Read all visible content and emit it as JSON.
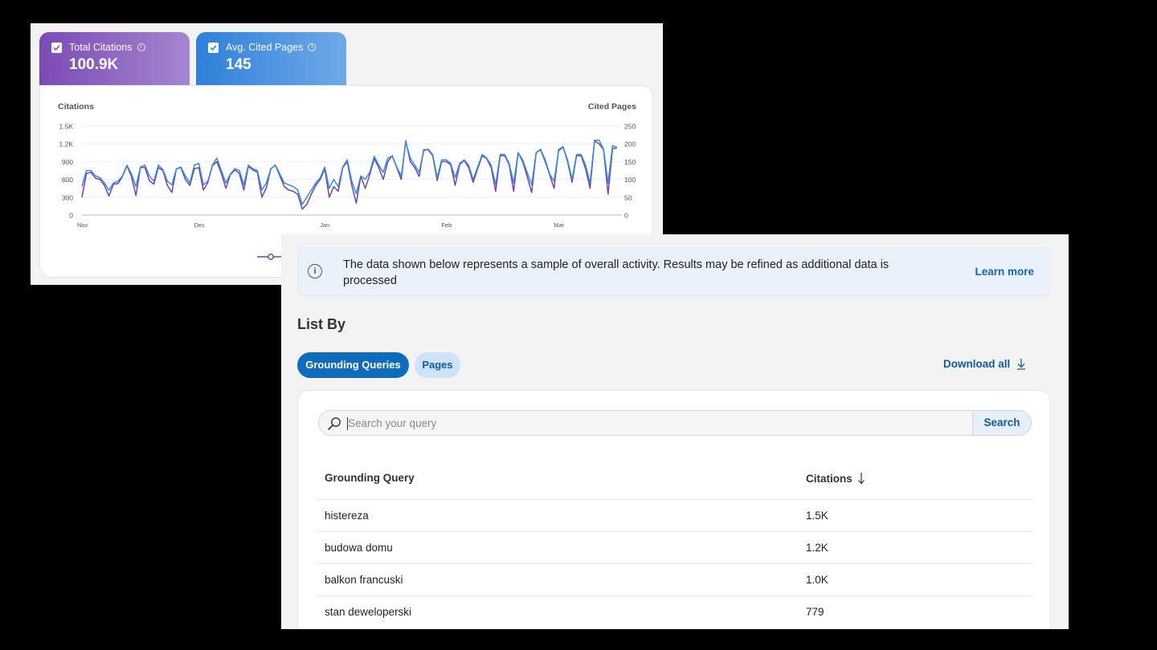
{
  "metrics": {
    "citations": {
      "label": "Total Citations",
      "value": "100.9K",
      "color": "#7b4bb5",
      "checked": true
    },
    "pages": {
      "label": "Avg. Cited Pages",
      "value": "145",
      "color": "#2f80d9",
      "checked": true
    }
  },
  "chart_data": {
    "type": "line",
    "left_axis_label": "Citations",
    "right_axis_label": "Cited Pages",
    "left_ticks": [
      "0",
      "300",
      "600",
      "900",
      "1.2K",
      "1.5K"
    ],
    "right_ticks": [
      "0",
      "50",
      "100",
      "150",
      "200",
      "250"
    ],
    "ylim_left": [
      0,
      1500
    ],
    "ylim_right": [
      0,
      250
    ],
    "x_ticks": [
      "Nov",
      "Dec",
      "Jan",
      "Feb",
      "Mar"
    ],
    "x_tick_index": [
      0,
      26,
      54,
      81,
      106
    ],
    "grid": true,
    "series": [
      {
        "name": "Total Citations",
        "axis": "left",
        "color": "#7b3fb0",
        "values": [
          300,
          700,
          720,
          620,
          600,
          500,
          320,
          520,
          530,
          650,
          830,
          650,
          330,
          800,
          800,
          580,
          520,
          800,
          750,
          500,
          380,
          780,
          800,
          600,
          500,
          780,
          800,
          420,
          550,
          830,
          900,
          700,
          450,
          680,
          760,
          700,
          420,
          820,
          760,
          720,
          300,
          460,
          780,
          840,
          660,
          480,
          420,
          400,
          350,
          100,
          180,
          350,
          500,
          600,
          780,
          300,
          480,
          400,
          800,
          900,
          500,
          200,
          650,
          450,
          680,
          950,
          800,
          600,
          900,
          1000,
          800,
          600,
          1250,
          900,
          800,
          650,
          1100,
          1100,
          1000,
          580,
          900,
          900,
          850,
          500,
          850,
          920,
          800,
          550,
          780,
          1000,
          950,
          800,
          400,
          1000,
          1000,
          850,
          400,
          1050,
          900,
          650,
          380,
          1050,
          1100,
          900,
          680,
          450,
          1100,
          1150,
          900,
          550,
          1000,
          1000,
          780,
          450,
          1250,
          1200,
          1100,
          350,
          1120,
          1130
        ]
      },
      {
        "name": "Avg. Cited Pages",
        "axis": "right",
        "color": "#2f8fdc",
        "values": [
          80,
          125,
          125,
          110,
          105,
          90,
          70,
          90,
          95,
          110,
          140,
          115,
          80,
          135,
          140,
          110,
          95,
          140,
          128,
          95,
          85,
          130,
          135,
          110,
          90,
          140,
          145,
          85,
          95,
          140,
          160,
          125,
          90,
          115,
          130,
          125,
          85,
          140,
          130,
          125,
          70,
          90,
          130,
          140,
          115,
          90,
          85,
          80,
          70,
          30,
          50,
          70,
          90,
          105,
          135,
          75,
          100,
          80,
          135,
          155,
          95,
          60,
          110,
          100,
          120,
          165,
          140,
          120,
          160,
          165,
          135,
          110,
          205,
          160,
          140,
          120,
          180,
          185,
          170,
          105,
          155,
          155,
          145,
          105,
          145,
          155,
          140,
          100,
          135,
          170,
          160,
          140,
          85,
          170,
          170,
          145,
          90,
          175,
          155,
          120,
          85,
          175,
          185,
          155,
          115,
          95,
          180,
          190,
          155,
          100,
          170,
          170,
          140,
          90,
          210,
          210,
          185,
          90,
          195,
          190
        ]
      }
    ],
    "legend_position": "bottom"
  },
  "banner": {
    "text": "The data shown below represents a sample of overall activity. Results may be refined as additional data is processed",
    "link": "Learn more"
  },
  "list_by": {
    "title": "List By",
    "tabs": [
      {
        "label": "Grounding Queries",
        "active": true
      },
      {
        "label": "Pages",
        "active": false
      }
    ],
    "download_label": "Download all"
  },
  "search": {
    "placeholder": "Search your query",
    "value": "",
    "button": "Search"
  },
  "table": {
    "columns": [
      "Grounding Query",
      "Citations"
    ],
    "sort": "descending",
    "rows": [
      {
        "query": "histereza",
        "citations": "1.5K"
      },
      {
        "query": "budowa domu",
        "citations": "1.2K"
      },
      {
        "query": "balkon francuski",
        "citations": "1.0K"
      },
      {
        "query": "stan deweloperski",
        "citations": "779"
      }
    ]
  }
}
